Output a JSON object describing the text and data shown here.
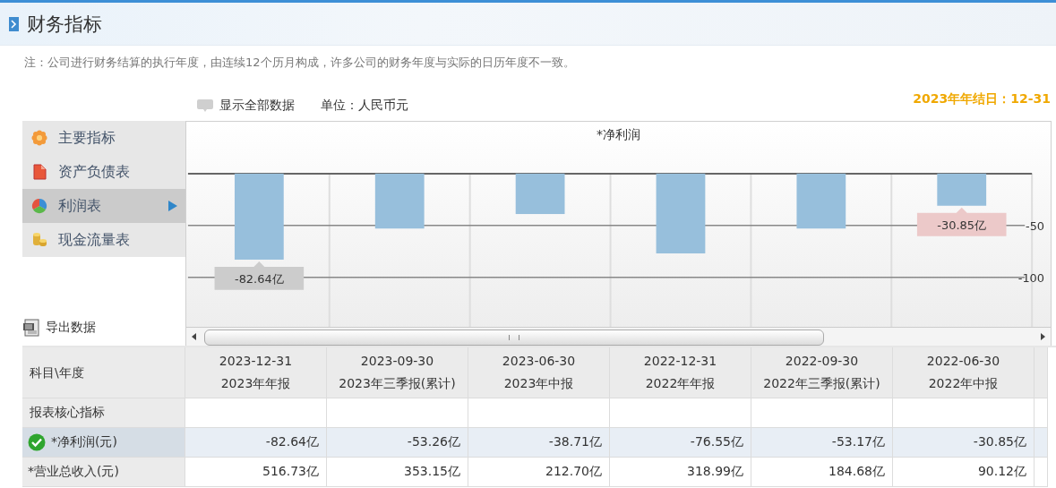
{
  "header": {
    "title": "财务指标"
  },
  "note": "注：公司进行财务结算的执行年度，由连续12个历月构成，许多公司的财务年度与实际的日历年度不一致。",
  "toolbar": {
    "show_all": "显示全部数据",
    "unit": "单位：人民币元",
    "fiscal_year_end": "2023年年结日：12-31"
  },
  "sidebar": {
    "items": [
      {
        "label": "主要指标",
        "kind": "flower",
        "selected": false
      },
      {
        "label": "资产负债表",
        "kind": "document",
        "selected": false
      },
      {
        "label": "利润表",
        "kind": "pie",
        "selected": true
      },
      {
        "label": "现金流量表",
        "kind": "coins",
        "selected": false
      }
    ],
    "export": "导出数据"
  },
  "chart": {
    "chart_data": {
      "type": "bar",
      "title": "*净利润",
      "values": [
        -83,
        -53,
        -39,
        -77,
        -53,
        -31
      ],
      "ylim": [
        -148,
        0
      ],
      "yticks": [
        {
          "value": -50,
          "label": "-50"
        },
        {
          "value": -100,
          "label": "-100"
        }
      ]
    },
    "bar_tooltips": [
      {
        "kind": "hover",
        "text": "-82.64亿"
      },
      {
        "kind": "none"
      },
      {
        "kind": "none"
      },
      {
        "kind": "none"
      },
      {
        "kind": "none"
      },
      {
        "kind": "highlight",
        "text": "-30.85亿"
      }
    ]
  },
  "table": {
    "corner": "科目\\年度",
    "columns": [
      {
        "date": "2023-12-31",
        "report": "2023年年报"
      },
      {
        "date": "2023-09-30",
        "report": "2023年三季报(累计)"
      },
      {
        "date": "2023-06-30",
        "report": "2023年中报"
      },
      {
        "date": "2022-12-31",
        "report": "2022年年报"
      },
      {
        "date": "2022-09-30",
        "report": "2022年三季报(累计)"
      },
      {
        "date": "2022-06-30",
        "report": "2022年中报"
      }
    ],
    "rows": [
      {
        "kind": "section",
        "label": "报表核心指标"
      },
      {
        "kind": "metric",
        "label": "*净利润(元)",
        "selected": true,
        "checked": true,
        "cells": [
          "-82.64亿",
          "-53.26亿",
          "-38.71亿",
          "-76.55亿",
          "-53.17亿",
          "-30.85亿"
        ]
      },
      {
        "kind": "metric",
        "label": "*营业总收入(元)",
        "selected": false,
        "checked": false,
        "cells": [
          "516.73亿",
          "353.15亿",
          "212.70亿",
          "318.99亿",
          "184.68亿",
          "90.12亿"
        ]
      }
    ]
  }
}
